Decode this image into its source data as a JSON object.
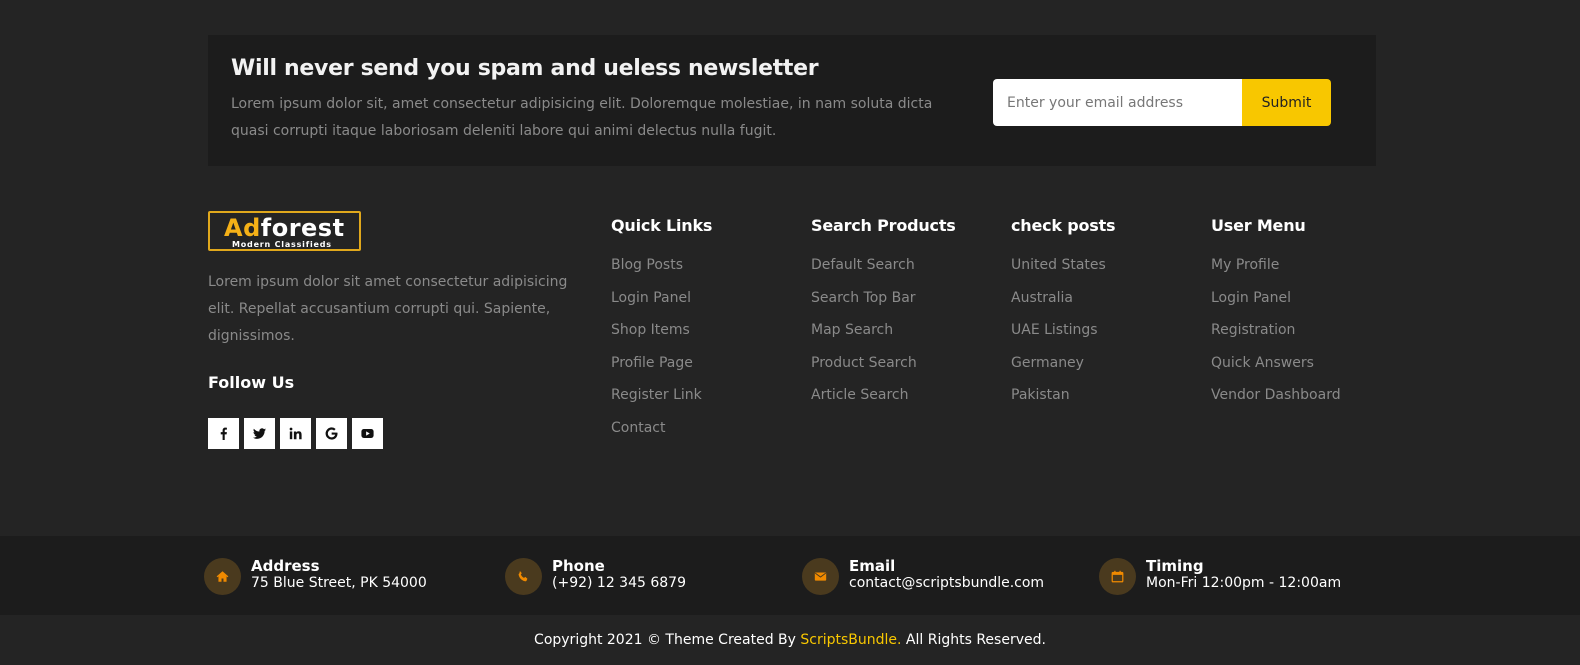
{
  "newsletter": {
    "title": "Will never send you spam and ueless newsletter",
    "text": "Lorem ipsum dolor sit, amet consectetur adipisicing elit. Doloremque molestiae, in nam soluta dicta quasi corrupti itaque laboriosam deleniti labore qui animi delectus nulla fugit.",
    "placeholder": "Enter your email address",
    "submit_label": "Submit"
  },
  "logo": {
    "ad": "Ad",
    "forest": "forest",
    "tagline": "Modern Classifieds"
  },
  "about": "Lorem ipsum dolor sit amet consectetur adipisicing elit. Repellat accusantium corrupti qui. Sapiente, dignissimos.",
  "follow": {
    "title": "Follow Us",
    "icons": [
      "facebook-icon",
      "twitter-icon",
      "linkedin-icon",
      "google-icon",
      "youtube-icon"
    ]
  },
  "columns": [
    {
      "title": "Quick Links",
      "items": [
        "Blog Posts",
        "Login Panel",
        "Shop Items",
        "Profile Page",
        "Register Link",
        "Contact"
      ]
    },
    {
      "title": "Search Products",
      "items": [
        "Default Search",
        "Search Top Bar",
        "Map Search",
        "Product Search",
        "Article Search"
      ]
    },
    {
      "title": "check posts",
      "items": [
        "United States",
        "Australia",
        "UAE Listings",
        "Germaney",
        "Pakistan"
      ]
    },
    {
      "title": "User Menu",
      "items": [
        "My Profile",
        "Login Panel",
        "Registration",
        "Quick Answers",
        "Vendor Dashboard"
      ]
    }
  ],
  "contact": [
    {
      "icon": "home-icon",
      "label": "Address",
      "value": "75 Blue Street, PK 54000"
    },
    {
      "icon": "phone-icon",
      "label": "Phone",
      "value": "(+92) 12 345 6879"
    },
    {
      "icon": "envelope-icon",
      "label": "Email",
      "value": "contact@scriptsbundle.com"
    },
    {
      "icon": "calendar-icon",
      "label": "Timing",
      "value": "Mon-Fri 12:00pm - 12:00am"
    }
  ],
  "copyright": {
    "before": "Copyright 2021 © Theme Created By ",
    "brand": "ScriptsBundle.",
    "after": " All Rights Reserved."
  },
  "colors": {
    "accent": "#f8c700",
    "logo_accent": "#f5b117",
    "icon_orange": "#f08a00",
    "background": "#242424",
    "panel": "#1c1c1c"
  }
}
